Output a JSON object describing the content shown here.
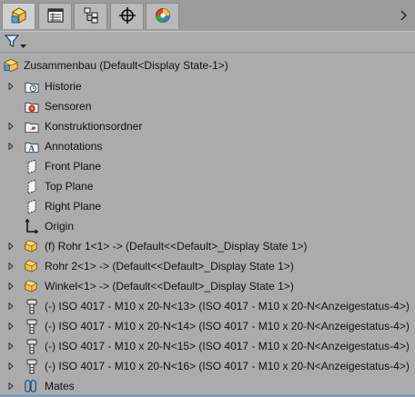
{
  "tabs": [
    {
      "name": "featuremanager",
      "icon": "feature-tree-icon"
    },
    {
      "name": "propertymanager",
      "icon": "property-manager-icon"
    },
    {
      "name": "configurationmanager",
      "icon": "configuration-manager-icon"
    },
    {
      "name": "dimxpertmanager",
      "icon": "target-crosshair-icon"
    },
    {
      "name": "displaymanager",
      "icon": "display-manager-icon"
    }
  ],
  "tree": {
    "root_label": "Zusammenbau  (Default<Display State-1>)",
    "items": [
      {
        "label": "Historie",
        "icon": "history-folder-icon",
        "expandable": true
      },
      {
        "label": "Sensoren",
        "icon": "sensor-icon",
        "expandable": false
      },
      {
        "label": "Konstruktionsordner",
        "icon": "design-folder-icon",
        "expandable": true
      },
      {
        "label": "Annotations",
        "icon": "annotations-folder-icon",
        "expandable": true
      },
      {
        "label": "Front Plane",
        "icon": "plane-icon",
        "expandable": false
      },
      {
        "label": "Top Plane",
        "icon": "plane-icon",
        "expandable": false
      },
      {
        "label": "Right Plane",
        "icon": "plane-icon",
        "expandable": false
      },
      {
        "label": "Origin",
        "icon": "origin-icon",
        "expandable": false
      },
      {
        "label": "(f) Rohr 1<1> -> (Default<<Default>_Display State 1>)",
        "icon": "part-icon",
        "expandable": true
      },
      {
        "label": "Rohr 2<1> -> (Default<<Default>_Display State 1>)",
        "icon": "part-icon",
        "expandable": true
      },
      {
        "label": "Winkel<1> -> (Default<<Default>_Display State 1>)",
        "icon": "part-icon",
        "expandable": true
      },
      {
        "label": "(-) ISO 4017 - M10 x 20-N<13> (ISO 4017 - M10 x 20-N<Anzeigestatus-4>)",
        "icon": "bolt-icon",
        "expandable": true
      },
      {
        "label": "(-) ISO 4017 - M10 x 20-N<14> (ISO 4017 - M10 x 20-N<Anzeigestatus-4>)",
        "icon": "bolt-icon",
        "expandable": true
      },
      {
        "label": "(-) ISO 4017 - M10 x 20-N<15> (ISO 4017 - M10 x 20-N<Anzeigestatus-4>)",
        "icon": "bolt-icon",
        "expandable": true
      },
      {
        "label": "(-) ISO 4017 - M10 x 20-N<16> (ISO 4017 - M10 x 20-N<Anzeigestatus-4>)",
        "icon": "bolt-icon",
        "expandable": true
      },
      {
        "label": "Mates",
        "icon": "mates-icon",
        "expandable": true
      }
    ]
  }
}
